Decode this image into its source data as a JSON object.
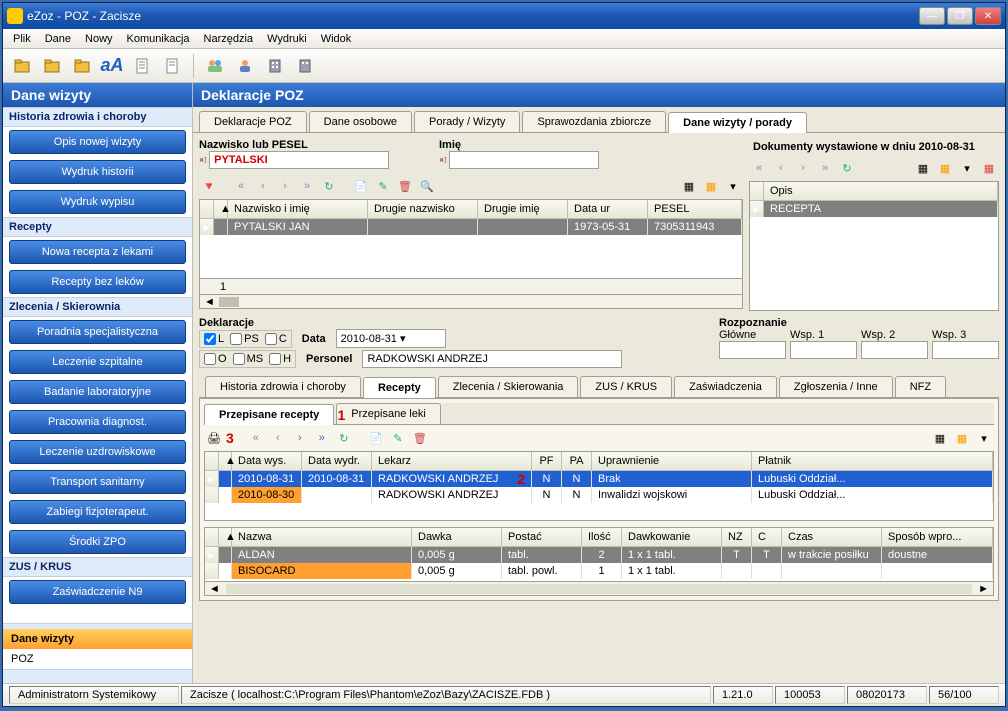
{
  "window": {
    "title": "eZoz - POZ - Zacisze"
  },
  "menu": [
    "Plik",
    "Dane",
    "Nowy",
    "Komunikacja",
    "Narzędzia",
    "Wydruki",
    "Widok"
  ],
  "sidebar": {
    "title": "Dane wizyty",
    "sections": [
      {
        "header": "Historia zdrowia i choroby",
        "items": [
          "Opis nowej wizyty",
          "Wydruk historii",
          "Wydruk wypisu"
        ]
      },
      {
        "header": "Recepty",
        "items": [
          "Nowa recepta z lekami",
          "Recepty bez leków"
        ]
      },
      {
        "header": "Zlecenia / Skierownia",
        "items": [
          "Poradnia specjalistyczna",
          "Leczenie szpitalne",
          "Badanie laboratoryjne",
          "Pracownia diagnost.",
          "Leczenie uzdrowiskowe",
          "Transport sanitarny",
          "Zabiegi fizjoterapeut.",
          "Środki ZPO"
        ]
      },
      {
        "header": "ZUS / KRUS",
        "items": [
          "Zaświadczenie N9"
        ]
      }
    ],
    "bottom": [
      {
        "label": "Dane wizyty",
        "active": true
      },
      {
        "label": "POZ",
        "active": false
      }
    ]
  },
  "content": {
    "title": "Deklaracje POZ",
    "main_tabs": [
      "Deklaracje POZ",
      "Dane osobowe",
      "Porady / Wizyty",
      "Sprawozdania zbiorcze",
      "Dane wizyty / porady"
    ],
    "main_tab_active": 4,
    "search": {
      "nazwisko_label": "Nazwisko lub PESEL",
      "nazwisko_value": "PYTALSKI",
      "imie_label": "Imię",
      "imie_value": ""
    },
    "patients_grid": {
      "headers": [
        "Nazwisko i imię",
        "Drugie nazwisko",
        "Drugie imię",
        "Data ur",
        "PESEL"
      ],
      "rows": [
        {
          "cells": [
            "PYTALSKI JAN",
            "",
            "",
            "1973-05-31",
            "7305311943"
          ],
          "selected": true
        }
      ],
      "record": "1"
    },
    "documents_panel": {
      "title": "Dokumenty wystawione w dniu 2010-08-31",
      "header": "Opis",
      "rows": [
        "RECEPTA"
      ]
    },
    "deklaracje": {
      "title": "Deklaracje",
      "checks": [
        "L",
        "PS",
        "C",
        "O",
        "MS",
        "H"
      ],
      "checked": "L",
      "data_label": "Data",
      "data_value": "2010-08-31",
      "personel_label": "Personel",
      "personel_value": "RADKOWSKI ANDRZEJ"
    },
    "rozpoznanie": {
      "title": "Rozpoznanie",
      "cols": [
        "Główne",
        "Wsp. 1",
        "Wsp. 2",
        "Wsp. 3"
      ]
    },
    "detail_tabs": [
      "Historia zdrowia i choroby",
      "Recepty",
      "Zlecenia / Skierowania",
      "ZUS / KRUS",
      "Zaświadczenia",
      "Zgłoszenia / Inne",
      "NFZ"
    ],
    "detail_tab_active": 1,
    "sub_tabs": [
      "Przepisane recepty",
      "Przepisane leki"
    ],
    "sub_tab_active": 0,
    "recepty_grid": {
      "headers": [
        "Data wys.",
        "Data wydr.",
        "Lekarz",
        "PF",
        "PA",
        "Uprawnienie",
        "Płatnik"
      ],
      "rows": [
        {
          "cells": [
            "2010-08-31",
            "2010-08-31",
            "RADKOWSKI ANDRZEJ",
            "N",
            "N",
            "Brak",
            "Lubuski Oddział..."
          ],
          "style": "blue"
        },
        {
          "cells": [
            "2010-08-30",
            "",
            "RADKOWSKI ANDRZEJ",
            "N",
            "N",
            "Inwalidzi wojskowi",
            "Lubuski Oddział..."
          ],
          "style": "orange-first"
        }
      ]
    },
    "leki_grid": {
      "headers": [
        "Nazwa",
        "Dawka",
        "Postać",
        "Ilość",
        "Dawkowanie",
        "NZ",
        "C",
        "Czas",
        "Sposób wpro..."
      ],
      "rows": [
        {
          "cells": [
            "ALDAN",
            "0,005 g",
            "tabl.",
            "2",
            "1 x 1 tabl.",
            "T",
            "T",
            "w trakcie posiłku",
            "doustne"
          ],
          "style": "selected"
        },
        {
          "cells": [
            "BISOCARD",
            "0,005 g",
            "tabl. powl.",
            "1",
            "1 x 1 tabl.",
            "",
            "",
            "",
            ""
          ],
          "style": "orange-first"
        }
      ]
    }
  },
  "status": {
    "user": "Administratorn Systemikowy",
    "db": "Zacisze ( localhost:C:\\Program Files\\Phantom\\eZoz\\Bazy\\ZACISZE.FDB )",
    "ver": "1.21.0",
    "a": "100053",
    "b": "08020173",
    "c": "56/100"
  },
  "annotations": {
    "a1": "1",
    "a2": "2",
    "a3": "3"
  }
}
